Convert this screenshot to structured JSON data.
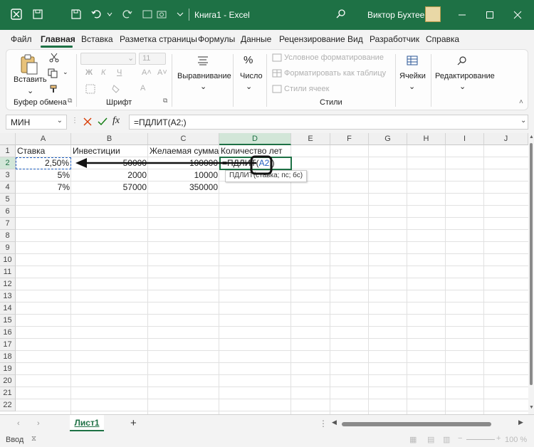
{
  "titlebar": {
    "title": "Книга1  -  Excel",
    "user": "Виктор Бухтеев",
    "icons": [
      "excel-logo-icon",
      "save-icon",
      "undo-icon",
      "redo-icon",
      "search-icon",
      "minimize-icon",
      "maximize-icon",
      "close-icon"
    ]
  },
  "menu": {
    "items": [
      "Файл",
      "Главная",
      "Вставка",
      "Разметка страницы",
      "Формулы",
      "Данные",
      "Рецензирование",
      "Вид",
      "Разработчик",
      "Справка"
    ],
    "active": "Главная"
  },
  "ribbon": {
    "paste": "Вставить",
    "clipboard": "Буфер обмена",
    "font_size": "11",
    "font_group": "Шрифт",
    "alignment": "Выравнивание",
    "number": "Число",
    "cond_format": "Условное форматирование",
    "format_table": "Форматировать как таблицу",
    "cell_styles": "Стили ячеек",
    "styles_group": "Стили",
    "cells": "Ячейки",
    "editing": "Редактирование",
    "bold": "Ж",
    "italic": "К",
    "underline": "Ч",
    "percent": "%"
  },
  "formula_bar": {
    "name_box": "МИН",
    "fx": "fx",
    "formula": "=ПДЛИТ(A2;)"
  },
  "grid": {
    "columns": [
      "A",
      "B",
      "C",
      "D",
      "E",
      "F",
      "G",
      "H",
      "I",
      "J"
    ],
    "rows": [
      "1",
      "2",
      "3",
      "4",
      "5",
      "6",
      "7",
      "8",
      "9",
      "10",
      "11",
      "12",
      "13",
      "14",
      "15",
      "16",
      "17",
      "18",
      "19",
      "20",
      "21",
      "22"
    ],
    "cells": {
      "A1": "Ставка",
      "B1": "Инвестиции",
      "C1": "Желаемая сумма",
      "D1": "Количество лет",
      "A2": "2,50%",
      "B2": "50000",
      "C2": "100000",
      "D2": "=ПДЛИТ(A2;)",
      "A3": "5%",
      "B3": "2000",
      "C3": "10000",
      "A4": "7%",
      "B4": "57000",
      "C4": "350000"
    },
    "tooltip": "ПДЛИТ(ставка; пс; бс)"
  },
  "sheets": {
    "active": "Лист1",
    "add": "+"
  },
  "status": {
    "mode": "Ввод",
    "zoom": "100 %"
  },
  "colors": {
    "accent": "#1e7145",
    "ref_blue": "#1f5fbf"
  }
}
